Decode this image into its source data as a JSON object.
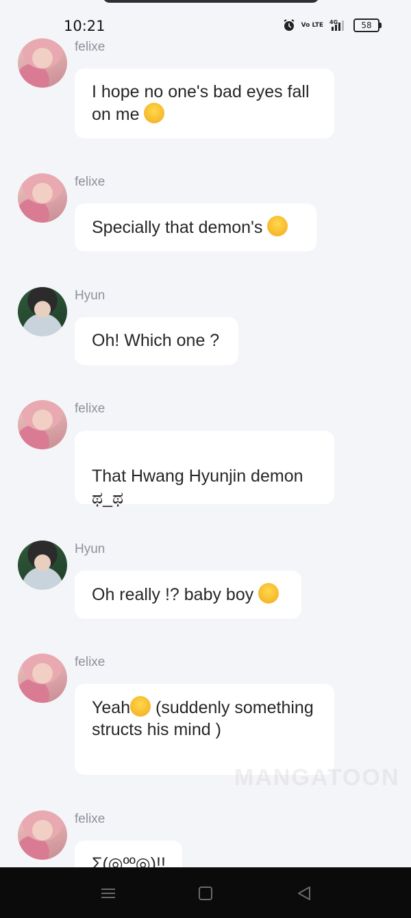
{
  "status_bar": {
    "time": "10:21",
    "volte_label": "Vo LTE",
    "network": "4G",
    "battery": "58"
  },
  "messages": [
    {
      "sender": "felixe",
      "text": "I hope no one's bad eyes fall on me",
      "emoji": "relieved-face-icon"
    },
    {
      "sender": "felixe",
      "text": "Specially that demon's",
      "emoji": "sneezing-face-icon"
    },
    {
      "sender": "Hyun",
      "text": "Oh! Which one ?"
    },
    {
      "sender": "felixe",
      "text": "That Hwang Hyunjin demon\nಥ_ಥ"
    },
    {
      "sender": "Hyun",
      "text": "Oh really !? baby boy",
      "emoji": "smirking-face-icon"
    },
    {
      "sender": "felixe",
      "text_before": "Yeah",
      "emoji": "relieved-face-icon",
      "text_after": " (suddenly something structs his mind )"
    },
    {
      "sender": "felixe",
      "text": "Σ(◎ºº◎)!!"
    }
  ],
  "watermark": "MANGATOON",
  "nav": {
    "icons": [
      "menu-icon",
      "home-square-icon",
      "back-triangle-icon"
    ]
  }
}
